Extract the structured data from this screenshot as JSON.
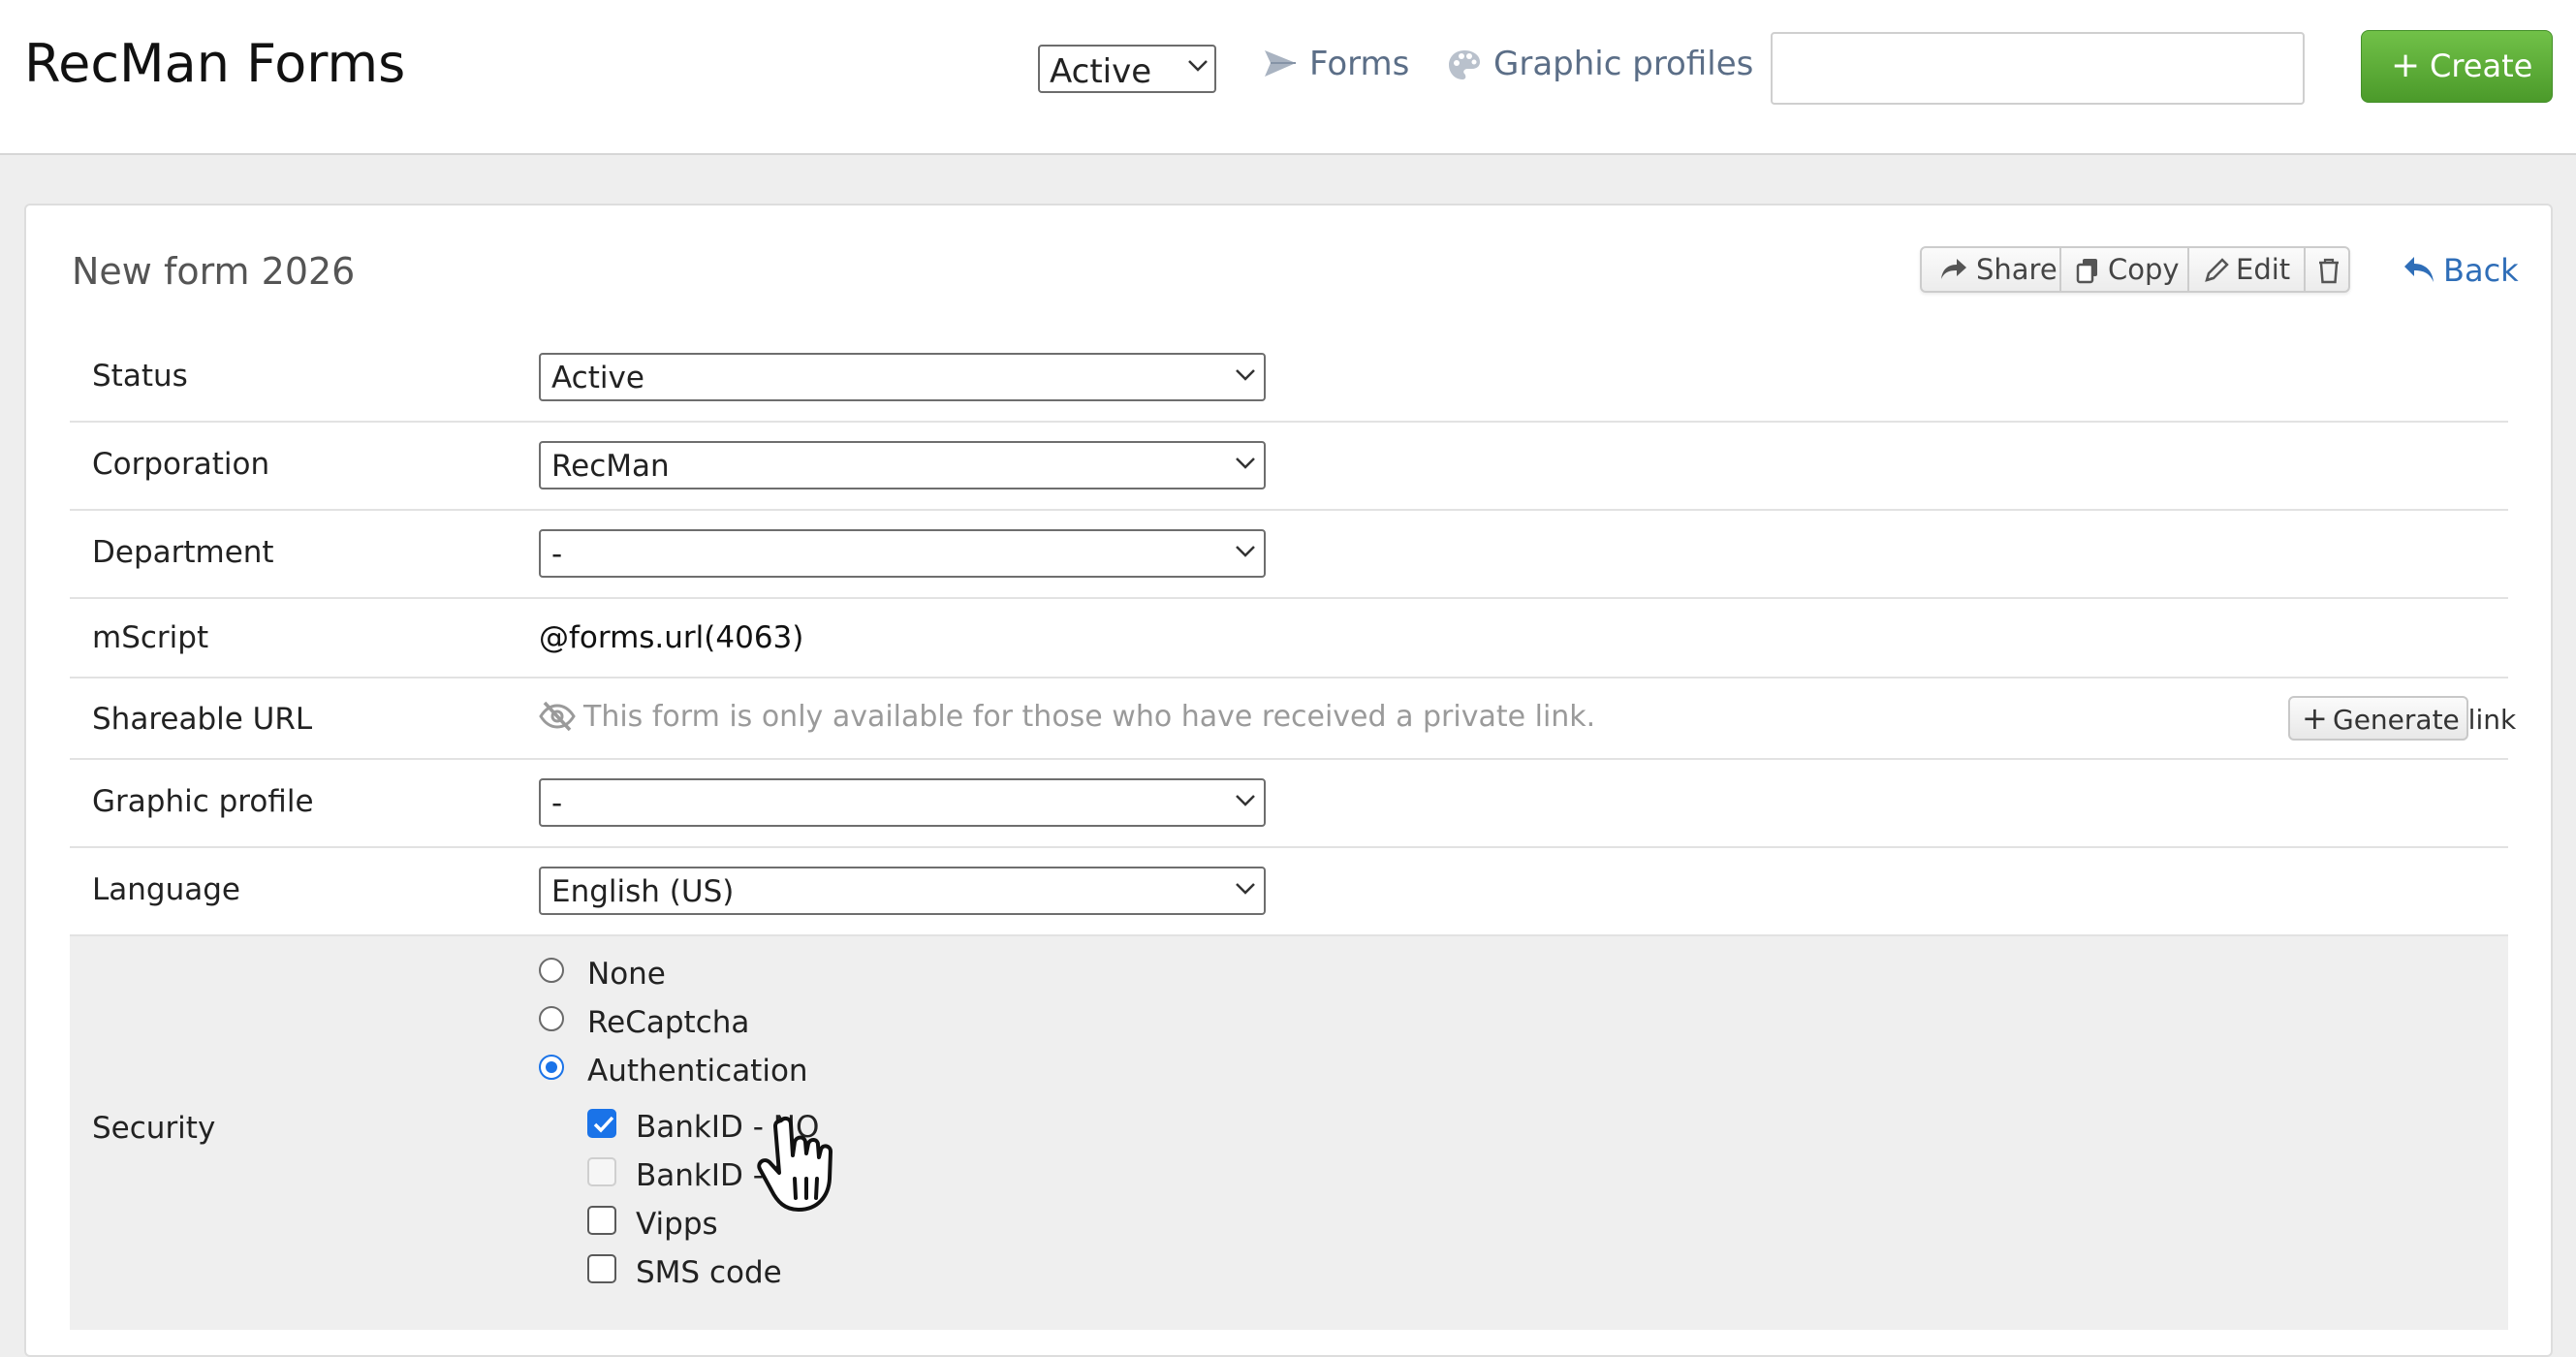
{
  "header": {
    "app_title": "RecMan Forms",
    "status_filter": "Active",
    "nav": {
      "forms": "Forms",
      "graphic_profiles": "Graphic profiles"
    },
    "search": {
      "value": "",
      "placeholder": ""
    },
    "create_button": {
      "icon": "+",
      "label": "Create"
    }
  },
  "form": {
    "title": "New form 2026",
    "actions": {
      "share": "Share",
      "copy": "Copy",
      "edit": "Edit",
      "delete_icon": "trash-icon"
    },
    "back": "Back",
    "fields": {
      "status": {
        "label": "Status",
        "value": "Active"
      },
      "corporation": {
        "label": "Corporation",
        "value": "RecMan"
      },
      "department": {
        "label": "Department",
        "value": "-"
      },
      "mscript": {
        "label": "mScript",
        "value": "@forms.url(4063)"
      },
      "shareable_url": {
        "label": "Shareable URL",
        "text": "This form is only available for those who have received a private link.",
        "button_icon": "+",
        "button": "Generate link"
      },
      "graphic_profile": {
        "label": "Graphic profile",
        "value": "-"
      },
      "language": {
        "label": "Language",
        "value": "English (US)"
      }
    },
    "security": {
      "label": "Security",
      "options": {
        "none": "None",
        "recaptcha": "ReCaptcha",
        "authentication": "Authentication"
      },
      "selected": "authentication",
      "methods": {
        "bankid_no": {
          "label": "BankID - NO",
          "checked": true
        },
        "bankid_se": {
          "label": "BankID - SE",
          "checked": false,
          "disabled": true
        },
        "vipps": {
          "label": "Vipps",
          "checked": false
        },
        "sms": {
          "label": "SMS code",
          "checked": false
        }
      }
    }
  },
  "colors": {
    "accent": "#1a73e8",
    "create_green": "#5aab35",
    "link_blue": "#2f6eb8",
    "nav_gray": "#5b6e87",
    "security_bg": "#efefef"
  }
}
